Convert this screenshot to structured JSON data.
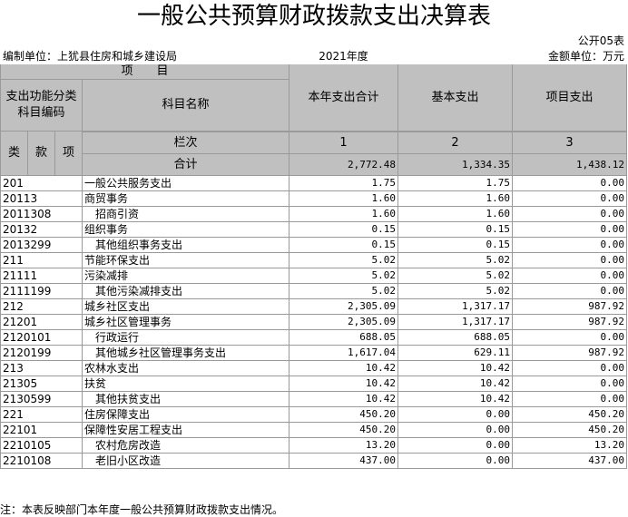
{
  "title": "一般公共预算财政拨款支出决算表",
  "table_no": "公开05表",
  "unit_label": "编制单位：上犹县住房和城乡建设局",
  "year": "2021年度",
  "amount_unit": "金额单位：万元",
  "headers": {
    "item": "项　　目",
    "code_group": "支出功能分类\n科目编码",
    "name": "科目名称",
    "total": "本年支出合计",
    "basic": "基本支出",
    "project": "项目支出",
    "lei": "类",
    "kuan": "款",
    "xiang": "项",
    "column_no": "栏次",
    "col1": "1",
    "col2": "2",
    "col3": "3",
    "sum_label": "合计"
  },
  "totals": {
    "total": "2,772.48",
    "basic": "1,334.35",
    "project": "1,438.12"
  },
  "rows": [
    {
      "code": "201",
      "name": "一般公共服务支出",
      "total": "1.75",
      "basic": "1.75",
      "project": "0.00"
    },
    {
      "code": "20113",
      "name": "商贸事务",
      "total": "1.60",
      "basic": "1.60",
      "project": "0.00"
    },
    {
      "code": "2011308",
      "name": "招商引资",
      "total": "1.60",
      "basic": "1.60",
      "project": "0.00"
    },
    {
      "code": "20132",
      "name": "组织事务",
      "total": "0.15",
      "basic": "0.15",
      "project": "0.00"
    },
    {
      "code": "2013299",
      "name": "其他组织事务支出",
      "total": "0.15",
      "basic": "0.15",
      "project": "0.00"
    },
    {
      "code": "211",
      "name": "节能环保支出",
      "total": "5.02",
      "basic": "5.02",
      "project": "0.00"
    },
    {
      "code": "21111",
      "name": "污染减排",
      "total": "5.02",
      "basic": "5.02",
      "project": "0.00"
    },
    {
      "code": "2111199",
      "name": "其他污染减排支出",
      "total": "5.02",
      "basic": "5.02",
      "project": "0.00"
    },
    {
      "code": "212",
      "name": "城乡社区支出",
      "total": "2,305.09",
      "basic": "1,317.17",
      "project": "987.92"
    },
    {
      "code": "21201",
      "name": "城乡社区管理事务",
      "total": "2,305.09",
      "basic": "1,317.17",
      "project": "987.92"
    },
    {
      "code": "2120101",
      "name": "行政运行",
      "total": "688.05",
      "basic": "688.05",
      "project": "0.00"
    },
    {
      "code": "2120199",
      "name": "其他城乡社区管理事务支出",
      "total": "1,617.04",
      "basic": "629.11",
      "project": "987.92"
    },
    {
      "code": "213",
      "name": "农林水支出",
      "total": "10.42",
      "basic": "10.42",
      "project": "0.00"
    },
    {
      "code": "21305",
      "name": "扶贫",
      "total": "10.42",
      "basic": "10.42",
      "project": "0.00"
    },
    {
      "code": "2130599",
      "name": "其他扶贫支出",
      "total": "10.42",
      "basic": "10.42",
      "project": "0.00"
    },
    {
      "code": "221",
      "name": "住房保障支出",
      "total": "450.20",
      "basic": "0.00",
      "project": "450.20"
    },
    {
      "code": "22101",
      "name": "保障性安居工程支出",
      "total": "450.20",
      "basic": "0.00",
      "project": "450.20"
    },
    {
      "code": "2210105",
      "name": "农村危房改造",
      "total": "13.20",
      "basic": "0.00",
      "project": "13.20"
    },
    {
      "code": "2210108",
      "name": "老旧小区改造",
      "total": "437.00",
      "basic": "0.00",
      "project": "437.00"
    }
  ],
  "note": "注：本表反映部门本年度一般公共预算财政拨款支出情况。"
}
